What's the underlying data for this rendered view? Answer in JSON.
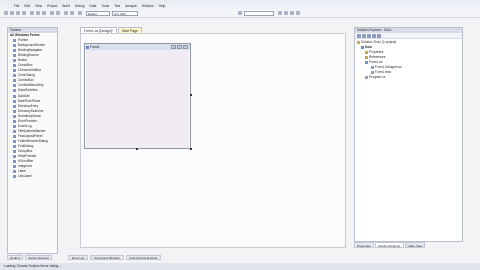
{
  "menu": [
    "File",
    "Edit",
    "View",
    "Project",
    "Build",
    "Debug",
    "Data",
    "Tools",
    "Test",
    "Analyze",
    "Window",
    "Help"
  ],
  "toolbar": {
    "config_select": "Debug",
    "platform_select": "Any CPU"
  },
  "toolbox": {
    "title": "Toolbox",
    "group": "All Windows Forms",
    "items": [
      "Pointer",
      "BackgroundWorker",
      "BindingNavigator",
      "BindingSource",
      "Button",
      "CheckBox",
      "CheckedListBox",
      "ColorDialog",
      "ComboBox",
      "ContextMenuStrip",
      "DataGridView",
      "DataSet",
      "DateTimePicker",
      "DirectoryEntry",
      "DirectorySearcher",
      "DomainUpDown",
      "ErrorProvider",
      "EventLog",
      "FileSystemWatcher",
      "FlowLayoutPanel",
      "FolderBrowserDialog",
      "FontDialog",
      "GroupBox",
      "HelpProvider",
      "HScrollBar",
      "ImageList",
      "Label",
      "LinkLabel"
    ],
    "tabs": [
      "Toolbox",
      "Server Explorer"
    ]
  },
  "document_tabs": {
    "designer": "Form1.cs [Design]*",
    "start_page": "Start Page"
  },
  "form": {
    "caption": "Form1"
  },
  "solution_explorer": {
    "title": "Solution Explorer - Solu...",
    "solution": "Solution 'Solu' (1 project)",
    "project": "Solu",
    "nodes": [
      "Properties",
      "References",
      "Form1.cs",
      "Form1.Designer.cs",
      "Form1.resx",
      "Program.cs"
    ],
    "tabs": [
      "Properties",
      "Solution Explorer",
      "Class View"
    ]
  },
  "bottom_tabs": [
    "Error List",
    "Command Window",
    "Find Symbol Results"
  ],
  "status": "Loading 'Choose Toolbox Items' dialog..."
}
